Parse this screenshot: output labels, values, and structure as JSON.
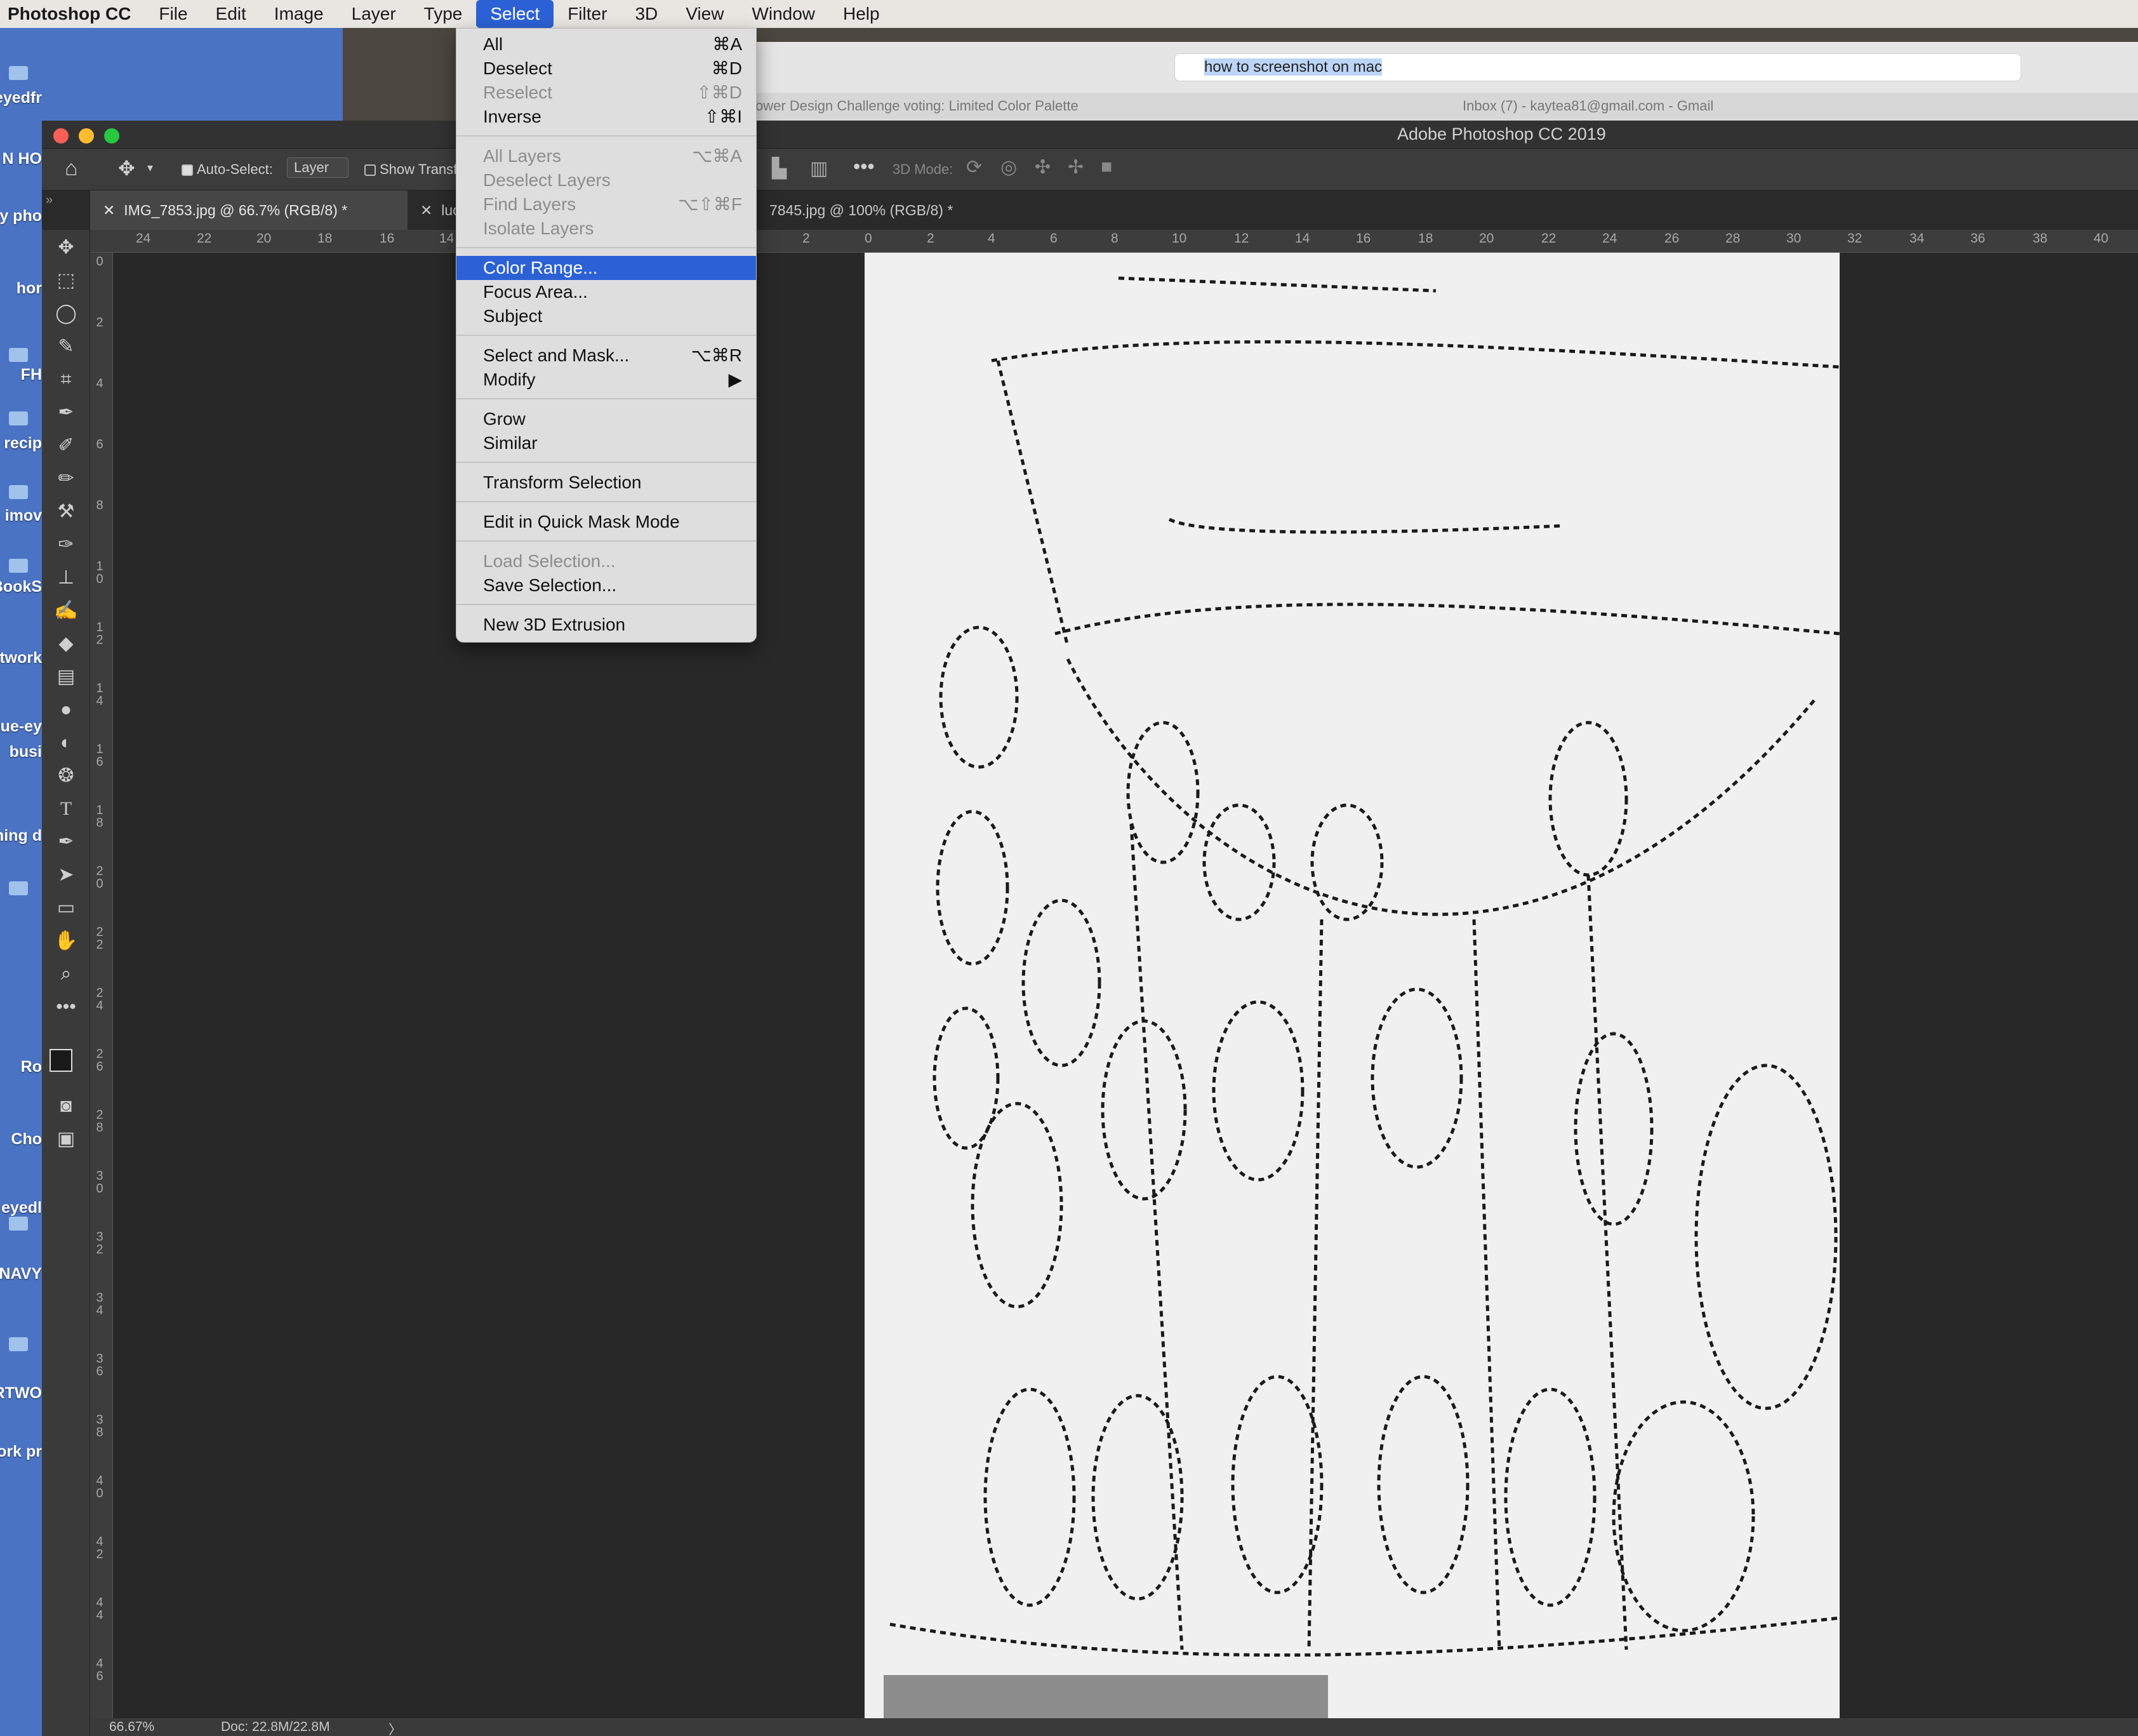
{
  "menubar": {
    "app": "Photoshop CC",
    "items": [
      "File",
      "Edit",
      "Image",
      "Layer",
      "Type",
      "Select",
      "Filter",
      "3D",
      "View",
      "Window",
      "Help"
    ],
    "active": "Select"
  },
  "desktop": {
    "labels": [
      "eyedfr",
      "N HO",
      "y pho",
      "hor",
      "FH",
      "recip",
      "imov",
      "BookS",
      "twork",
      "lue-ey",
      "busi",
      "ning d",
      "Ro",
      "Cho",
      "eyedl",
      "NAVY",
      "RTWO",
      "ork pr"
    ]
  },
  "browser": {
    "url": "how to screenshot on mac",
    "tabs": [
      "ower Design Challenge voting: Limited Color Palette",
      "Inbox (7) - kaytea81@gmail.com - Gmail"
    ]
  },
  "window": {
    "title": "Adobe Photoshop CC 2019"
  },
  "options": {
    "auto_select_label": "Auto-Select:",
    "auto_select_value": "Layer",
    "show_transform": "Show Transf",
    "mode_3d": "3D Mode:"
  },
  "doc_tabs": [
    "IMG_7853.jpg @ 66.7% (RGB/8) *",
    "luca be",
    "7845.jpg @ 100% (RGB/8) *"
  ],
  "select_menu": {
    "groups": [
      [
        {
          "label": "All",
          "shortcut": "⌘A",
          "enabled": true
        },
        {
          "label": "Deselect",
          "shortcut": "⌘D",
          "enabled": true
        },
        {
          "label": "Reselect",
          "shortcut": "⇧⌘D",
          "enabled": false
        },
        {
          "label": "Inverse",
          "shortcut": "⇧⌘I",
          "enabled": true
        }
      ],
      [
        {
          "label": "All Layers",
          "shortcut": "⌥⌘A",
          "enabled": false
        },
        {
          "label": "Deselect Layers",
          "shortcut": "",
          "enabled": false
        },
        {
          "label": "Find Layers",
          "shortcut": "⌥⇧⌘F",
          "enabled": false
        },
        {
          "label": "Isolate Layers",
          "shortcut": "",
          "enabled": false
        }
      ],
      [
        {
          "label": "Color Range...",
          "shortcut": "",
          "enabled": true,
          "highlighted": true
        },
        {
          "label": "Focus Area...",
          "shortcut": "",
          "enabled": true
        },
        {
          "label": "Subject",
          "shortcut": "",
          "enabled": true
        }
      ],
      [
        {
          "label": "Select and Mask...",
          "shortcut": "⌥⌘R",
          "enabled": true
        },
        {
          "label": "Modify",
          "shortcut": "▶",
          "enabled": true
        }
      ],
      [
        {
          "label": "Grow",
          "shortcut": "",
          "enabled": true
        },
        {
          "label": "Similar",
          "shortcut": "",
          "enabled": true
        }
      ],
      [
        {
          "label": "Transform Selection",
          "shortcut": "",
          "enabled": true
        }
      ],
      [
        {
          "label": "Edit in Quick Mask Mode",
          "shortcut": "",
          "enabled": true
        }
      ],
      [
        {
          "label": "Load Selection...",
          "shortcut": "",
          "enabled": false
        },
        {
          "label": "Save Selection...",
          "shortcut": "",
          "enabled": true
        }
      ],
      [
        {
          "label": "New 3D Extrusion",
          "shortcut": "",
          "enabled": true
        }
      ]
    ]
  },
  "hruler_ticks": [
    "24",
    "22",
    "20",
    "18",
    "16",
    "14",
    "2",
    "0",
    "2",
    "4",
    "6",
    "8",
    "10",
    "12",
    "14",
    "16",
    "18",
    "20",
    "22",
    "24",
    "26",
    "28",
    "30",
    "32",
    "34",
    "36",
    "38",
    "40"
  ],
  "vruler_ticks": [
    "0",
    "2",
    "4",
    "6",
    "8",
    "10",
    "12",
    "14",
    "16",
    "18",
    "20",
    "22",
    "24",
    "26",
    "28",
    "30",
    "32",
    "34",
    "36",
    "38",
    "40",
    "42",
    "44",
    "46"
  ],
  "status": {
    "zoom": "66.67%",
    "doc": "Doc: 22.8M/22.8M",
    "arrow": "〉"
  },
  "colors": {
    "menu_highlight": "#2c61d6",
    "desktop_blue": "#4a73c3",
    "ps_dark": "#282828"
  }
}
